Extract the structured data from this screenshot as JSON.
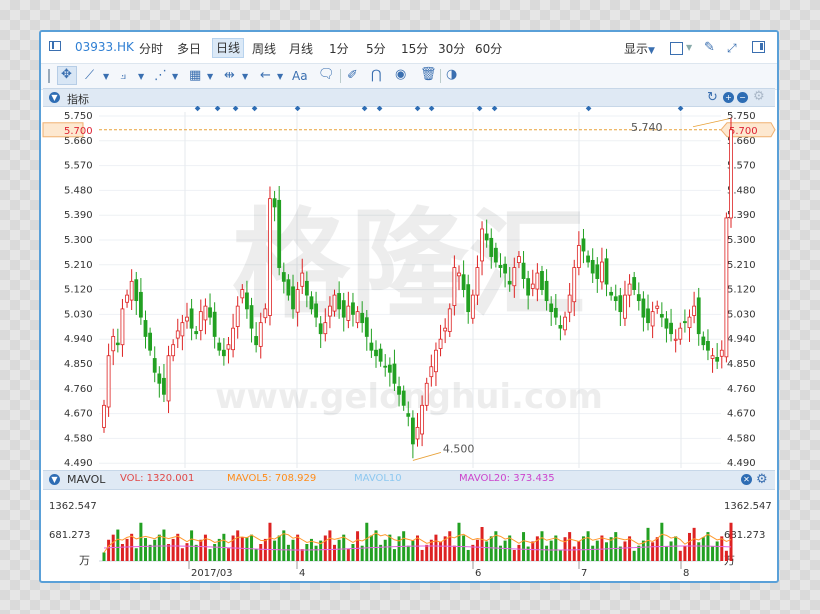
{
  "toolbar": {
    "ticker": "03933.HK",
    "periods": [
      "分时",
      "多日",
      "日线",
      "周线",
      "月线",
      "1分",
      "5分",
      "15分",
      "30分",
      "60分"
    ],
    "active_period": "日线",
    "display_label": "显示"
  },
  "indicator_panel": {
    "label": "指标"
  },
  "price_chart": {
    "y_ticks": [
      "5.750",
      "5.660",
      "5.570",
      "5.480",
      "5.390",
      "5.300",
      "5.210",
      "5.120",
      "5.030",
      "4.940",
      "4.850",
      "4.760",
      "4.670",
      "4.580",
      "4.490"
    ],
    "current_price": "5.700",
    "high_label": "5.740",
    "low_label": "4.500",
    "watermark": "格隆汇",
    "watermark_url": "www.gelonghui.com"
  },
  "volume_panel": {
    "label": "MAVOL",
    "vol": "VOL: 1320.001",
    "ma5": "MAVOL5: 708.929",
    "ma10": "MAVOL10",
    "ma20": "MAVOL20: 373.435",
    "y_ticks": [
      "1362.547",
      "681.273"
    ],
    "unit": "万"
  },
  "x_axis": {
    "labels": [
      "2017/03",
      "4",
      "6",
      "7",
      "8"
    ]
  },
  "colors": {
    "up": "#dd2222",
    "down": "#22a022",
    "accent": "#2e6db4",
    "ma5": "#ff9a2e",
    "ma10": "#8dc8f0",
    "ma20": "#e066e0"
  }
}
